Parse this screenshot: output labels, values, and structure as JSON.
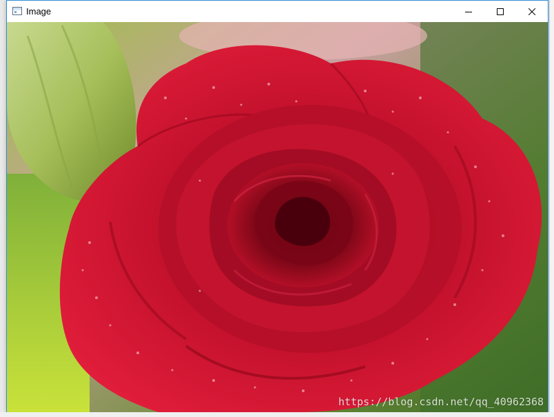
{
  "window": {
    "title": "Image",
    "controls": {
      "minimize": "minimize-icon",
      "maximize": "maximize-icon",
      "close": "close-icon"
    }
  },
  "image": {
    "subject": "red rose with dew drops",
    "watermark": "https://blog.csdn.net/qq_40962368"
  },
  "colors": {
    "window_border": "#2f8dd6",
    "titlebar_bg": "#ffffff",
    "rose_red": "#c8102e",
    "leaf_green": "#a9c25a"
  }
}
